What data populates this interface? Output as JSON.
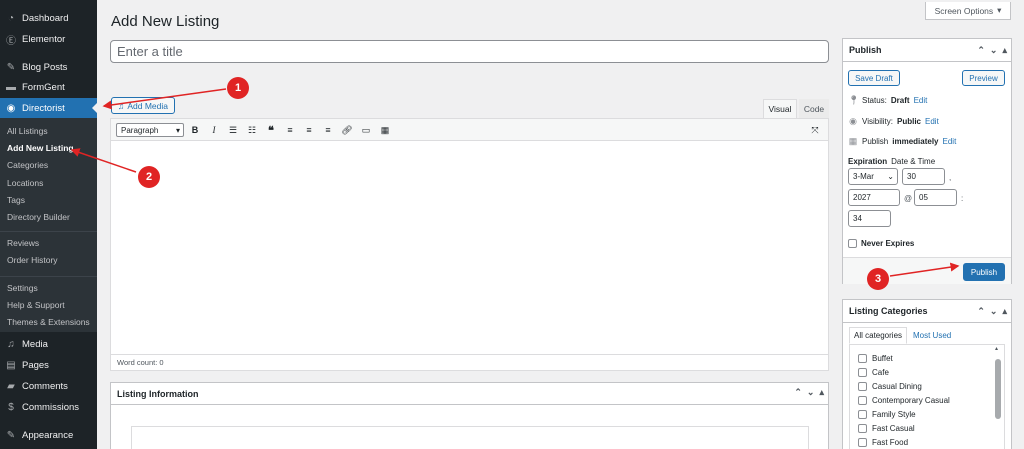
{
  "sidebar": {
    "items": [
      {
        "label": "Dashboard",
        "icon": "dashboard-icon",
        "glyph": "◔"
      },
      {
        "label": "Elementor",
        "icon": "elementor-icon",
        "glyph": "Ⓔ"
      },
      {
        "label": "Blog Posts",
        "icon": "pushpin-icon",
        "glyph": "✎"
      },
      {
        "label": "FormGent",
        "icon": "formgent-icon",
        "glyph": "▬"
      },
      {
        "label": "Directorist",
        "icon": "directorist-icon",
        "glyph": "◉"
      }
    ],
    "submenu": [
      "All Listings",
      "Add New Listing",
      "Categories",
      "Locations",
      "Tags",
      "Directory Builder",
      "Reviews",
      "Order History",
      "Settings",
      "Help & Support",
      "Themes & Extensions"
    ],
    "lower_items": [
      {
        "label": "Media",
        "icon": "media-icon",
        "glyph": "♫"
      },
      {
        "label": "Pages",
        "icon": "pages-icon",
        "glyph": "▤"
      },
      {
        "label": "Comments",
        "icon": "comments-icon",
        "glyph": "▰"
      },
      {
        "label": "Commissions",
        "icon": "commissions-icon",
        "glyph": "$"
      },
      {
        "label": "Appearance",
        "icon": "appearance-icon",
        "glyph": "✎"
      }
    ]
  },
  "header": {
    "screen_options": "Screen Options",
    "page_title": "Add New Listing",
    "title_placeholder": "Enter a title"
  },
  "editor": {
    "add_media": "Add Media",
    "tab_visual": "Visual",
    "tab_code": "Code",
    "format": "Paragraph",
    "word_count": "Word count: 0"
  },
  "listing_info": {
    "title": "Listing Information"
  },
  "publish": {
    "title": "Publish",
    "save_draft": "Save Draft",
    "preview": "Preview",
    "status_label": "Status:",
    "status_value": "Draft",
    "visibility_label": "Visibility:",
    "visibility_value": "Public",
    "publish_label": "Publish",
    "publish_value": "immediately",
    "edit": "Edit",
    "expiration_label": "Expiration",
    "expiration_rest": "Date & Time",
    "month": "3-Mar",
    "day": "30",
    "year": "2027",
    "hour": "05",
    "minute": "34",
    "comma": ",",
    "at": "@",
    "colon": ":",
    "never_expires": "Never Expires",
    "publish_button": "Publish"
  },
  "categories": {
    "title": "Listing Categories",
    "tab_all": "All categories",
    "tab_most": "Most Used",
    "items": [
      "Buffet",
      "Cafe",
      "Casual Dining",
      "Contemporary Casual",
      "Family Style",
      "Fast Casual",
      "Fast Food"
    ]
  },
  "annotations": [
    "1",
    "2",
    "3"
  ],
  "colors": {
    "accent": "#2271b1",
    "sidebar": "#1d2327",
    "annotation": "#e02424"
  }
}
